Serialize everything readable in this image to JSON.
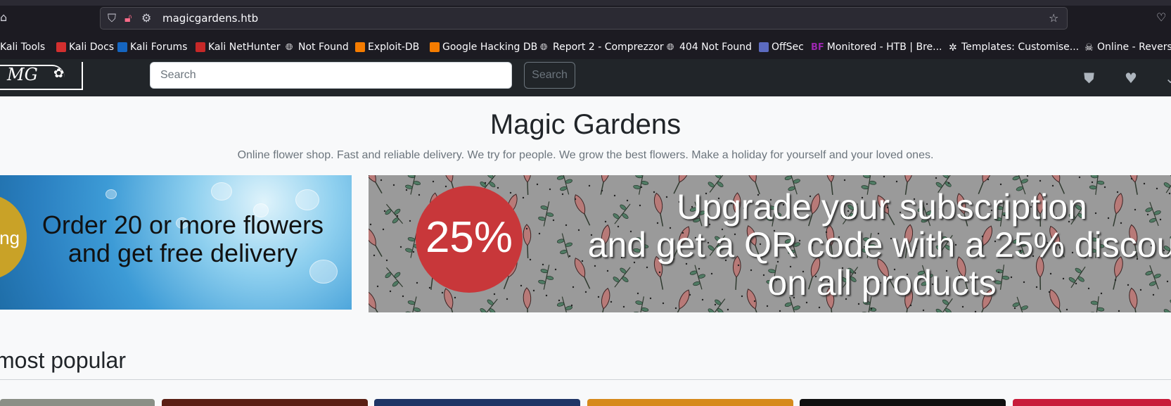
{
  "browser": {
    "url": "magicgardens.htb",
    "bookmarks": [
      {
        "label": "Kali Tools",
        "color": "#2b2a33"
      },
      {
        "label": "Kali Docs",
        "color": "#d32f2f"
      },
      {
        "label": "Kali Forums",
        "color": "#1565c0"
      },
      {
        "label": "Kali NetHunter",
        "color": "#c62828"
      },
      {
        "label": "Not Found",
        "color": "globe"
      },
      {
        "label": "Exploit-DB",
        "color": "#f57c00"
      },
      {
        "label": "Google Hacking DB",
        "color": "#f57c00"
      },
      {
        "label": "Report 2 - Comprezzor",
        "color": "globe"
      },
      {
        "label": "404 Not Found",
        "color": "globe"
      },
      {
        "label": "OffSec",
        "color": "#5c6bc0"
      },
      {
        "label": "Monitored - HTB | Bre...",
        "color": "#9c27b0",
        "prefix": "BF"
      },
      {
        "label": "Templates: Customise...",
        "color": "joomla"
      },
      {
        "label": "Online - Revers",
        "color": "skull"
      }
    ]
  },
  "navbar": {
    "logo_text": "MG",
    "search_placeholder": "Search",
    "search_button": "Search"
  },
  "hero": {
    "title": "Magic Gardens",
    "subtitle": "Online flower shop. Fast and reliable delivery. We try for people. We grow the best flowers. Make a holiday for yourself and your loved ones."
  },
  "banners": {
    "delivery_badge": "ng",
    "delivery_line1": "Order 20 or more flowers",
    "delivery_line2": "and get free delivery",
    "discount": "25%",
    "promo_line1": "Upgrade your subscription",
    "promo_line2": "and get a QR code with a 25% discou",
    "promo_line3": "on all products"
  },
  "section": {
    "title": "most popular"
  },
  "colors": {
    "navbar": "#212529",
    "page_bg": "#f8f9fa",
    "discount_red": "#c8373a"
  }
}
